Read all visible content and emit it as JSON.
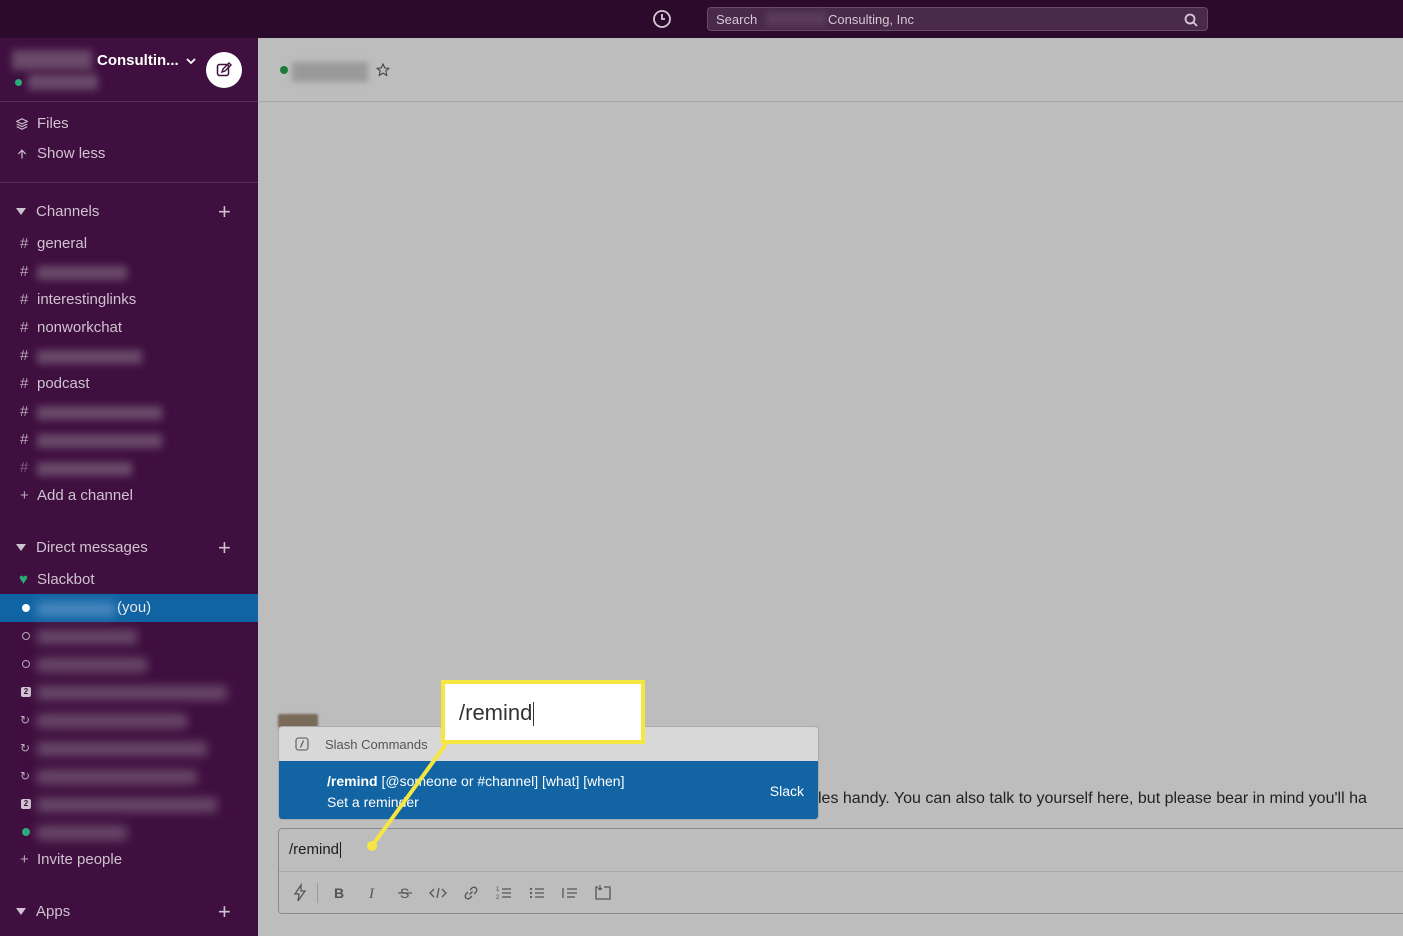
{
  "topbar": {
    "search_label": "Search",
    "workspace_name": "Consulting, Inc"
  },
  "workspace": {
    "name": "Consultin..."
  },
  "sidebar": {
    "nav_items": [
      {
        "label": "Files",
        "icon": "layers-icon"
      },
      {
        "label": "Show less",
        "icon": "arrow-up-icon"
      }
    ],
    "channels": {
      "title": "Channels",
      "items": [
        {
          "label": "general"
        },
        {
          "label": ""
        },
        {
          "label": "interestinglinks"
        },
        {
          "label": "nonworkchat"
        },
        {
          "label": ""
        },
        {
          "label": "podcast"
        },
        {
          "label": ""
        },
        {
          "label": ""
        },
        {
          "label": ""
        }
      ],
      "add_label": "Add a channel"
    },
    "direct_messages": {
      "title": "Direct messages",
      "slackbot": "Slackbot",
      "you_suffix": "(you)",
      "invite_label": "Invite people"
    },
    "apps": {
      "title": "Apps"
    }
  },
  "main": {
    "message_text": "les handy. You can also talk to yourself here, but please bear in mind you'll ha"
  },
  "popup": {
    "header": "Slash Commands",
    "command": "/remind",
    "args": "[@someone or #channel] [what] [when]",
    "description": "Set a reminder",
    "source": "Slack"
  },
  "composer": {
    "value": "/remind"
  },
  "callout": {
    "text": "/remind"
  },
  "colors": {
    "sidebar_bg": "#3f0f3f",
    "topbar_bg": "#2b0a2b",
    "selected_bg": "#1164a3",
    "callout_border": "#f5e642",
    "presence_green": "#2bac76"
  }
}
